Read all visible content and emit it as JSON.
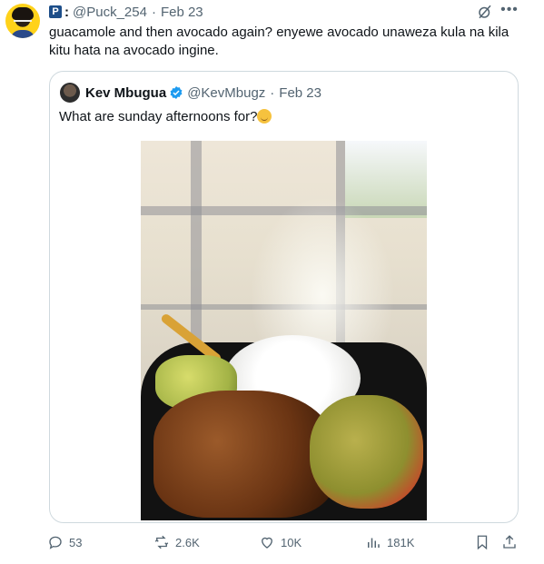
{
  "tweet": {
    "badge_letter": "P",
    "handle": "@Puck_254",
    "date": "Feb 23",
    "separator": "·",
    "text": "guacamole and then avocado again? enyewe avocado unaweza kula na kila kitu hata na avocado ingine."
  },
  "quote": {
    "name": "Kev Mbugua",
    "handle": "@KevMbugz",
    "date": "Feb 23",
    "separator": "·",
    "text": "What are sunday afternoons for?"
  },
  "actions": {
    "replies": "53",
    "reposts": "2.6K",
    "likes": "10K",
    "views": "181K"
  },
  "colors": {
    "text": "#0f1419",
    "secondary": "#536471",
    "border": "#cfd9de",
    "verified": "#1d9bf0"
  }
}
